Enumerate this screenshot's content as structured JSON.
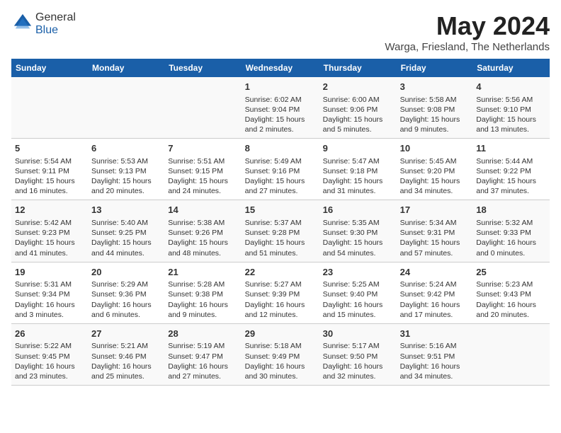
{
  "header": {
    "logo_general": "General",
    "logo_blue": "Blue",
    "month_title": "May 2024",
    "location": "Warga, Friesland, The Netherlands"
  },
  "days_of_week": [
    "Sunday",
    "Monday",
    "Tuesday",
    "Wednesday",
    "Thursday",
    "Friday",
    "Saturday"
  ],
  "weeks": [
    [
      {
        "day": "",
        "info": ""
      },
      {
        "day": "",
        "info": ""
      },
      {
        "day": "",
        "info": ""
      },
      {
        "day": "1",
        "info": "Sunrise: 6:02 AM\nSunset: 9:04 PM\nDaylight: 15 hours\nand 2 minutes."
      },
      {
        "day": "2",
        "info": "Sunrise: 6:00 AM\nSunset: 9:06 PM\nDaylight: 15 hours\nand 5 minutes."
      },
      {
        "day": "3",
        "info": "Sunrise: 5:58 AM\nSunset: 9:08 PM\nDaylight: 15 hours\nand 9 minutes."
      },
      {
        "day": "4",
        "info": "Sunrise: 5:56 AM\nSunset: 9:10 PM\nDaylight: 15 hours\nand 13 minutes."
      }
    ],
    [
      {
        "day": "5",
        "info": "Sunrise: 5:54 AM\nSunset: 9:11 PM\nDaylight: 15 hours\nand 16 minutes."
      },
      {
        "day": "6",
        "info": "Sunrise: 5:53 AM\nSunset: 9:13 PM\nDaylight: 15 hours\nand 20 minutes."
      },
      {
        "day": "7",
        "info": "Sunrise: 5:51 AM\nSunset: 9:15 PM\nDaylight: 15 hours\nand 24 minutes."
      },
      {
        "day": "8",
        "info": "Sunrise: 5:49 AM\nSunset: 9:16 PM\nDaylight: 15 hours\nand 27 minutes."
      },
      {
        "day": "9",
        "info": "Sunrise: 5:47 AM\nSunset: 9:18 PM\nDaylight: 15 hours\nand 31 minutes."
      },
      {
        "day": "10",
        "info": "Sunrise: 5:45 AM\nSunset: 9:20 PM\nDaylight: 15 hours\nand 34 minutes."
      },
      {
        "day": "11",
        "info": "Sunrise: 5:44 AM\nSunset: 9:22 PM\nDaylight: 15 hours\nand 37 minutes."
      }
    ],
    [
      {
        "day": "12",
        "info": "Sunrise: 5:42 AM\nSunset: 9:23 PM\nDaylight: 15 hours\nand 41 minutes."
      },
      {
        "day": "13",
        "info": "Sunrise: 5:40 AM\nSunset: 9:25 PM\nDaylight: 15 hours\nand 44 minutes."
      },
      {
        "day": "14",
        "info": "Sunrise: 5:38 AM\nSunset: 9:26 PM\nDaylight: 15 hours\nand 48 minutes."
      },
      {
        "day": "15",
        "info": "Sunrise: 5:37 AM\nSunset: 9:28 PM\nDaylight: 15 hours\nand 51 minutes."
      },
      {
        "day": "16",
        "info": "Sunrise: 5:35 AM\nSunset: 9:30 PM\nDaylight: 15 hours\nand 54 minutes."
      },
      {
        "day": "17",
        "info": "Sunrise: 5:34 AM\nSunset: 9:31 PM\nDaylight: 15 hours\nand 57 minutes."
      },
      {
        "day": "18",
        "info": "Sunrise: 5:32 AM\nSunset: 9:33 PM\nDaylight: 16 hours\nand 0 minutes."
      }
    ],
    [
      {
        "day": "19",
        "info": "Sunrise: 5:31 AM\nSunset: 9:34 PM\nDaylight: 16 hours\nand 3 minutes."
      },
      {
        "day": "20",
        "info": "Sunrise: 5:29 AM\nSunset: 9:36 PM\nDaylight: 16 hours\nand 6 minutes."
      },
      {
        "day": "21",
        "info": "Sunrise: 5:28 AM\nSunset: 9:38 PM\nDaylight: 16 hours\nand 9 minutes."
      },
      {
        "day": "22",
        "info": "Sunrise: 5:27 AM\nSunset: 9:39 PM\nDaylight: 16 hours\nand 12 minutes."
      },
      {
        "day": "23",
        "info": "Sunrise: 5:25 AM\nSunset: 9:40 PM\nDaylight: 16 hours\nand 15 minutes."
      },
      {
        "day": "24",
        "info": "Sunrise: 5:24 AM\nSunset: 9:42 PM\nDaylight: 16 hours\nand 17 minutes."
      },
      {
        "day": "25",
        "info": "Sunrise: 5:23 AM\nSunset: 9:43 PM\nDaylight: 16 hours\nand 20 minutes."
      }
    ],
    [
      {
        "day": "26",
        "info": "Sunrise: 5:22 AM\nSunset: 9:45 PM\nDaylight: 16 hours\nand 23 minutes."
      },
      {
        "day": "27",
        "info": "Sunrise: 5:21 AM\nSunset: 9:46 PM\nDaylight: 16 hours\nand 25 minutes."
      },
      {
        "day": "28",
        "info": "Sunrise: 5:19 AM\nSunset: 9:47 PM\nDaylight: 16 hours\nand 27 minutes."
      },
      {
        "day": "29",
        "info": "Sunrise: 5:18 AM\nSunset: 9:49 PM\nDaylight: 16 hours\nand 30 minutes."
      },
      {
        "day": "30",
        "info": "Sunrise: 5:17 AM\nSunset: 9:50 PM\nDaylight: 16 hours\nand 32 minutes."
      },
      {
        "day": "31",
        "info": "Sunrise: 5:16 AM\nSunset: 9:51 PM\nDaylight: 16 hours\nand 34 minutes."
      },
      {
        "day": "",
        "info": ""
      }
    ]
  ]
}
